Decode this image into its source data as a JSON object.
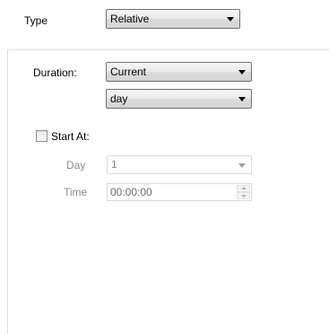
{
  "type_row": {
    "label": "Type",
    "value": "Relative",
    "arrow_icon": "chevron-down-icon"
  },
  "duration": {
    "label": "Duration:",
    "mode_value": "Current",
    "unit_value": "day"
  },
  "start_at": {
    "label": "Start At:",
    "checked": false,
    "day_label": "Day",
    "day_value": "1",
    "time_label": "Time",
    "time_value": "00:00:00"
  },
  "colors": {
    "panel_border": "#d5dfe5",
    "disabled_text": "#8a8a8a"
  }
}
